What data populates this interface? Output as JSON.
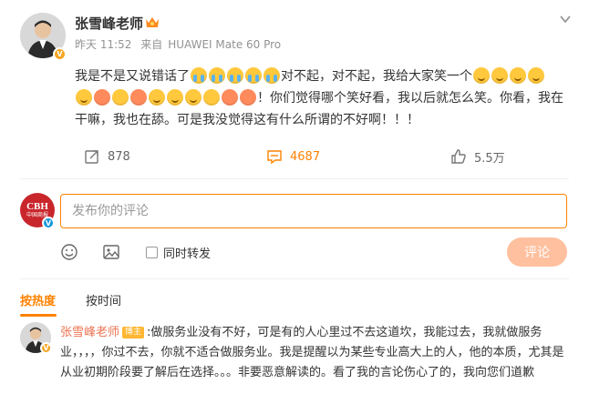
{
  "post": {
    "author_name": "张雪峰老师",
    "time": "昨天 11:52",
    "source_prefix": "来自",
    "source_device": "HUAWEI Mate 60 Pro",
    "text_part1": "我是不是又说错话了",
    "text_part2": "对不起，对不起，我给大家笑一个",
    "text_part3": "！你们觉得哪个笑好看，我以后就怎么笑。你看，我在干嘛，我也在舔。可是我没觉得这有什么所谓的不好啊！！！",
    "emoji_row1_crying": [
      "cry-emoji",
      "cry-emoji",
      "cry-emoji",
      "cry-emoji",
      "cry-emoji"
    ],
    "emoji_row1_smiles": [
      "smile-emoji",
      "smile-emoji",
      "grin-emoji",
      "laugh-emoji"
    ],
    "emoji_row2": [
      "laugh-emoji",
      "tongue-emoji",
      "wow-emoji",
      "kiss-emoji",
      "smirk-emoji",
      "grin-emoji",
      "hee-emoji",
      "think-emoji",
      "shy-emoji",
      "kiss-emoji"
    ]
  },
  "actions": {
    "repost_count": "878",
    "comment_count": "4687",
    "like_count": "5.5万"
  },
  "composer": {
    "placeholder": "发布你的评论",
    "user_avatar_text": "CBH",
    "user_avatar_subtext": "中国商报",
    "sync_label": "同时转发",
    "submit_label": "评论"
  },
  "sort": {
    "hot_label": "按热度",
    "time_label": "按时间"
  },
  "comment": {
    "author_name": "张雪峰老师",
    "badge": "博主",
    "text": ":做服务业没有不好，可是有的人心里过不去这道坎，我能过去，我就做服务业，，，，你过不去，你就不适合做服务业。我是提醒以为某些专业高大上的人，他的本质，尤其是从业初期阶段要了解后在选择。。。非要恶意解读的。看了我的言论伤心了的，我向您们道歉"
  },
  "colors": {
    "accent": "#ff8200",
    "name_link": "#eb7350",
    "submit_disabled": "#ffc09f",
    "muted": "#939393"
  }
}
